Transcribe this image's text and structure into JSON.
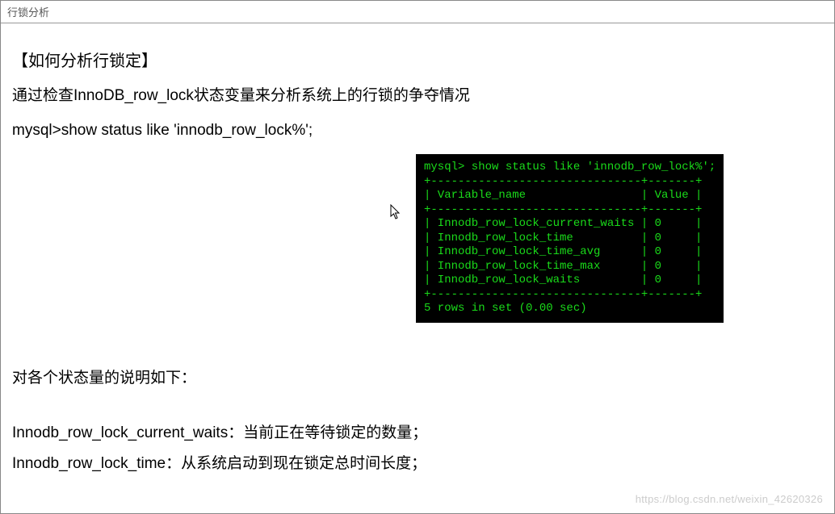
{
  "window": {
    "title": "行锁分析"
  },
  "body": {
    "heading": "【如何分析行锁定】",
    "intro": "通过检查InnoDB_row_lock状态变量来分析系统上的行锁的争夺情况",
    "command": "mysql>show status like 'innodb_row_lock%';",
    "status_heading": "对各个状态量的说明如下：",
    "items": [
      "Innodb_row_lock_current_waits：当前正在等待锁定的数量；",
      "Innodb_row_lock_time：从系统启动到现在锁定总时间长度；"
    ]
  },
  "terminal": {
    "prompt": "mysql> show status like 'innodb_row_lock%';",
    "header_var": "Variable_name",
    "header_val": "Value",
    "rows": [
      {
        "name": "Innodb_row_lock_current_waits",
        "value": "0"
      },
      {
        "name": "Innodb_row_lock_time",
        "value": "0"
      },
      {
        "name": "Innodb_row_lock_time_avg",
        "value": "0"
      },
      {
        "name": "Innodb_row_lock_time_max",
        "value": "0"
      },
      {
        "name": "Innodb_row_lock_waits",
        "value": "0"
      }
    ],
    "footer": "5 rows in set (0.00 sec)"
  },
  "watermark": "https://blog.csdn.net/weixin_42620326"
}
